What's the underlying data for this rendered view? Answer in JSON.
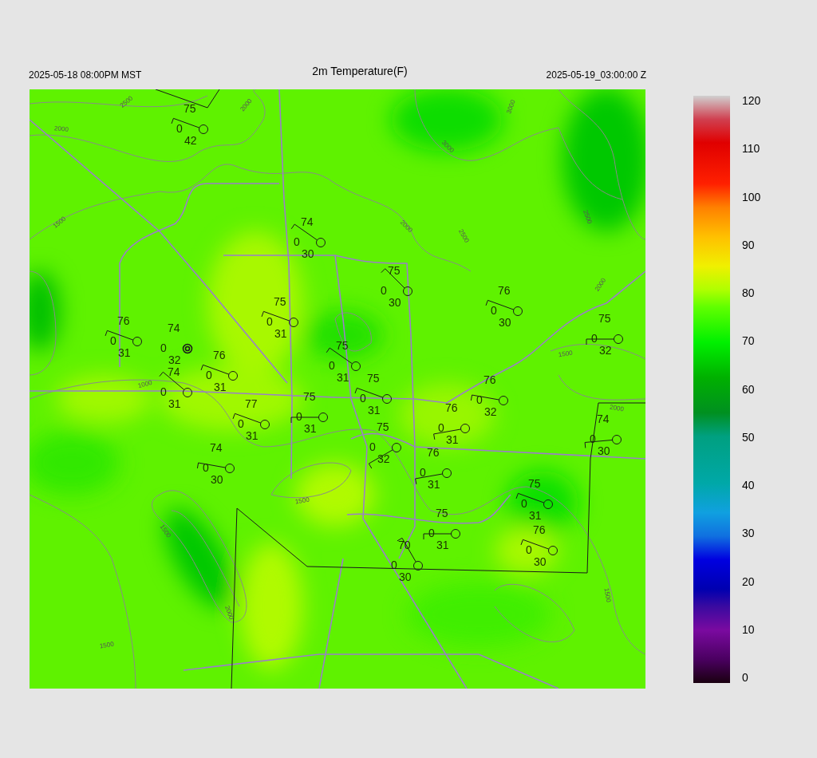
{
  "header": {
    "local_time": "2025-05-18 08:00PM MST",
    "title": "2m Temperature(F)",
    "valid_time": "2025-05-19_03:00:00 Z"
  },
  "map": {
    "stations": [
      {
        "kind": "barb",
        "temperature": "75",
        "visibility": "0",
        "dewpoint": "42"
      },
      {
        "kind": "barb",
        "temperature": "74",
        "visibility": "0",
        "dewpoint": "30"
      },
      {
        "kind": "barb",
        "temperature": "75",
        "visibility": "0",
        "dewpoint": "30"
      },
      {
        "kind": "barb",
        "temperature": "76",
        "visibility": "0",
        "dewpoint": "30"
      },
      {
        "kind": "barb",
        "temperature": "75",
        "visibility": "0",
        "dewpoint": "31"
      },
      {
        "kind": "barb",
        "temperature": "76",
        "visibility": "0",
        "dewpoint": "31"
      },
      {
        "kind": "calm",
        "temperature": "74",
        "visibility": "0",
        "dewpoint": "32"
      },
      {
        "kind": "barb",
        "temperature": "75",
        "visibility": "0",
        "dewpoint": "32"
      },
      {
        "kind": "barb",
        "temperature": "75",
        "visibility": "0",
        "dewpoint": "31"
      },
      {
        "kind": "barb",
        "temperature": "76",
        "visibility": "0",
        "dewpoint": "31"
      },
      {
        "kind": "barb",
        "temperature": "74",
        "visibility": "0",
        "dewpoint": "31"
      },
      {
        "kind": "barb",
        "temperature": "75",
        "visibility": "0",
        "dewpoint": "31"
      },
      {
        "kind": "barb",
        "temperature": "76",
        "visibility": "0",
        "dewpoint": "32"
      },
      {
        "kind": "barb",
        "temperature": "77",
        "visibility": "0",
        "dewpoint": "31"
      },
      {
        "kind": "barb",
        "temperature": "75",
        "visibility": "0",
        "dewpoint": "31"
      },
      {
        "kind": "barb",
        "temperature": "76",
        "visibility": "0",
        "dewpoint": "31"
      },
      {
        "kind": "barb",
        "temperature": "75",
        "visibility": "0",
        "dewpoint": "32"
      },
      {
        "kind": "barb",
        "temperature": "74",
        "visibility": "0",
        "dewpoint": "30"
      },
      {
        "kind": "barb",
        "temperature": "74",
        "visibility": "0",
        "dewpoint": "30"
      },
      {
        "kind": "barb",
        "temperature": "76",
        "visibility": "0",
        "dewpoint": "31"
      },
      {
        "kind": "barb",
        "temperature": "75",
        "visibility": "0",
        "dewpoint": "31"
      },
      {
        "kind": "barb",
        "temperature": "75",
        "visibility": "0",
        "dewpoint": "31"
      },
      {
        "kind": "barb",
        "temperature": "76",
        "visibility": "0",
        "dewpoint": "30"
      },
      {
        "kind": "barb",
        "temperature": "70",
        "visibility": "0",
        "dewpoint": "30"
      }
    ],
    "contour_labels": [
      "2500",
      "2000",
      "2000",
      "3000",
      "3000",
      "2000",
      "2500",
      "2500",
      "2000",
      "1500",
      "1500",
      "1000",
      "2000",
      "1500",
      "1500",
      "1500",
      "2000",
      "1500"
    ]
  },
  "colorbar": {
    "ticks": [
      "120",
      "110",
      "100",
      "90",
      "80",
      "70",
      "60",
      "50",
      "40",
      "30",
      "20",
      "10",
      "0"
    ]
  }
}
